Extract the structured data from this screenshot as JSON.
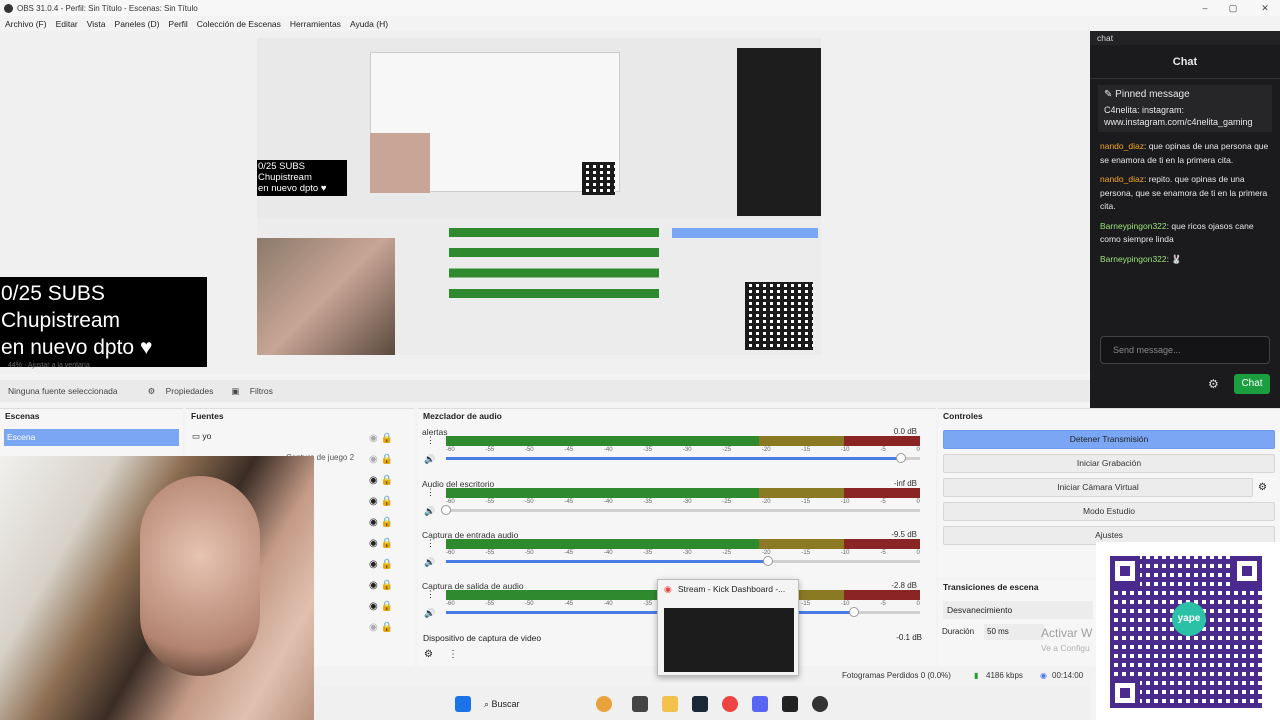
{
  "window": {
    "title": "OBS 31.0.4 - Perfil: Sin Título - Escenas: Sin Título",
    "minimize": "–",
    "maximize": "▢",
    "close": "✕"
  },
  "menu": [
    "Archivo (F)",
    "Editar",
    "Vista",
    "Paneles (D)",
    "Perfil",
    "Colección de Escenas",
    "Herramientas",
    "Ayuda (H)"
  ],
  "overlay": {
    "line1": "0/25 SUBS",
    "line2": "Chupistream",
    "line3": "en nuevo dpto ♥"
  },
  "preview_status": "44% · Ajustar a la ventana",
  "toolbar": {
    "no_source": "Ninguna fuente seleccionada",
    "properties": "Propiedades",
    "filters": "Filtros"
  },
  "chat": {
    "dock_title": "chat",
    "title": "Chat",
    "pinned_label": "Pinned message",
    "pinned_text": "C4nelita: instagram: www.instagram.com/c4nelita_gaming",
    "messages": [
      {
        "user": "nando_diaz",
        "text": ": que opinas de una persona que se enamora de ti en la primera cita."
      },
      {
        "user": "nando_diaz",
        "text": ": repito. que opinas de una persona, que se enamora de ti en la primera cita."
      },
      {
        "user": "Barneypingon322",
        "text": ": que ricos ojasos cane como siempre linda"
      },
      {
        "user": "Barneypingon322",
        "text": ": 🐰"
      }
    ],
    "input_placeholder": "Send message...",
    "send_label": "Chat"
  },
  "scenes": {
    "title": "Escenas",
    "items": [
      "Escena"
    ]
  },
  "sources": {
    "title": "Fuentes",
    "items": [
      "yo",
      "Captura de juego 2"
    ]
  },
  "mixer": {
    "title": "Mezclador de audio",
    "tracks": [
      {
        "name": "alertas",
        "db": "0.0 dB",
        "level": 0.96
      },
      {
        "name": "Audio del escritorio",
        "db": "-inf dB",
        "level": 0.0
      },
      {
        "name": "Captura de entrada audio",
        "db": "-9.5 dB",
        "level": 0.68
      },
      {
        "name": "Captura de salida de audio",
        "db": "-2.8 dB",
        "level": 0.86
      }
    ],
    "scale": [
      "-60",
      "-55",
      "-50",
      "-45",
      "-40",
      "-35",
      "-30",
      "-25",
      "-20",
      "-15",
      "-10",
      "-5",
      "0"
    ],
    "last_track": "Dispositivo de captura de video",
    "last_db": "-0.1 dB"
  },
  "controls": {
    "title": "Controles",
    "stop_stream": "Detener Transmisión",
    "start_recording": "Iniciar Grabación",
    "virtual_camera": "Iniciar Cámara Virtual",
    "studio_mode": "Modo Estudio",
    "settings": "Ajustes"
  },
  "transitions": {
    "title": "Transiciones de escena",
    "selected": "Desvanecimiento",
    "duration_label": "Duración",
    "duration_value": "50 ms"
  },
  "popup": {
    "title": "Stream - Kick Dashboard -..."
  },
  "statusbar": {
    "frames": "Fotogramas Perdidos 0 (0.0%)",
    "bitrate": "4186 kbps",
    "time": "00:14:00"
  },
  "taskbar": {
    "search": "Buscar"
  },
  "windows_notice": {
    "line1": "Activar W",
    "line2": "Ve a Configu"
  },
  "colors": {
    "accent": "#7aa6f4",
    "chat_bg": "#1b1b1d",
    "send_green": "#1a9e3f",
    "qr_purple": "#4a2a8c"
  }
}
